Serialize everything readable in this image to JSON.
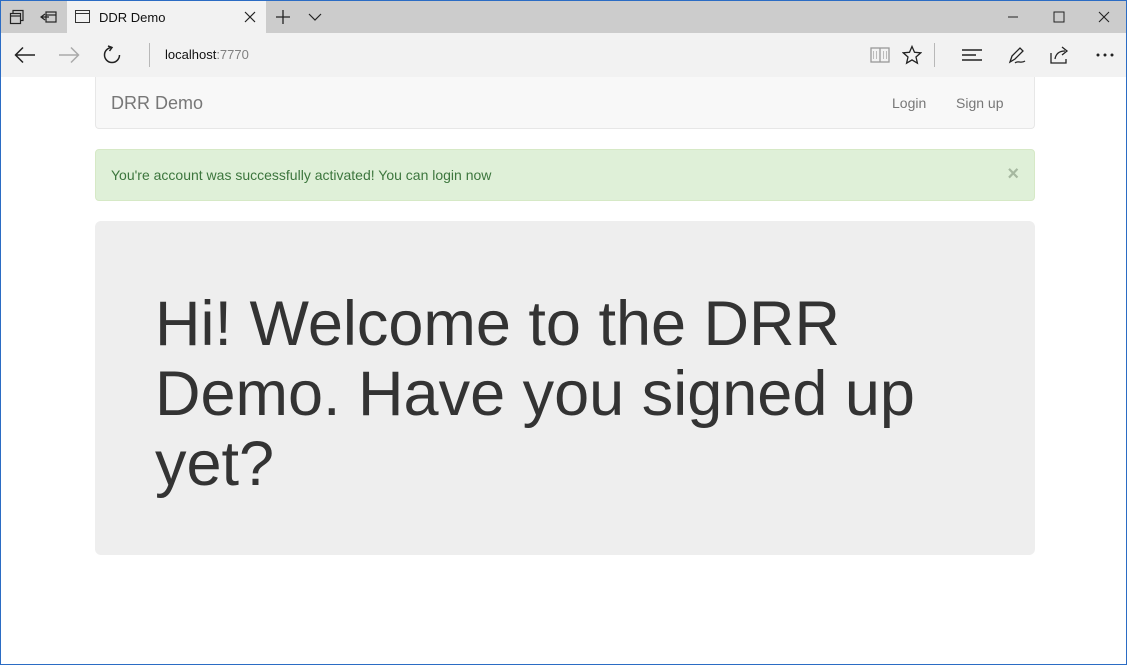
{
  "browser": {
    "tab_title": "DDR Demo",
    "url_host": "localhost",
    "url_port": ":7770",
    "icons": [
      "tab-list-icon",
      "set-aside-tabs-icon",
      "close-icon",
      "new-tab-icon",
      "tab-preview-chevron-icon",
      "minimize-icon",
      "maximize-icon",
      "window-close-icon",
      "back-arrow-icon",
      "forward-arrow-icon",
      "refresh-icon",
      "reading-view-icon",
      "favorite-star-icon",
      "hub-icon",
      "web-note-pen-icon",
      "share-icon",
      "more-icon"
    ]
  },
  "app_nav": {
    "brand": "DRR Demo",
    "login": "Login",
    "signup": "Sign up"
  },
  "alert": {
    "message": "You're account was successfully activated! You can login now",
    "close_glyph": "×",
    "color": "#dff0d8"
  },
  "jumbotron": {
    "heading": "Hi! Welcome to the DRR Demo. Have you signed up yet?"
  }
}
